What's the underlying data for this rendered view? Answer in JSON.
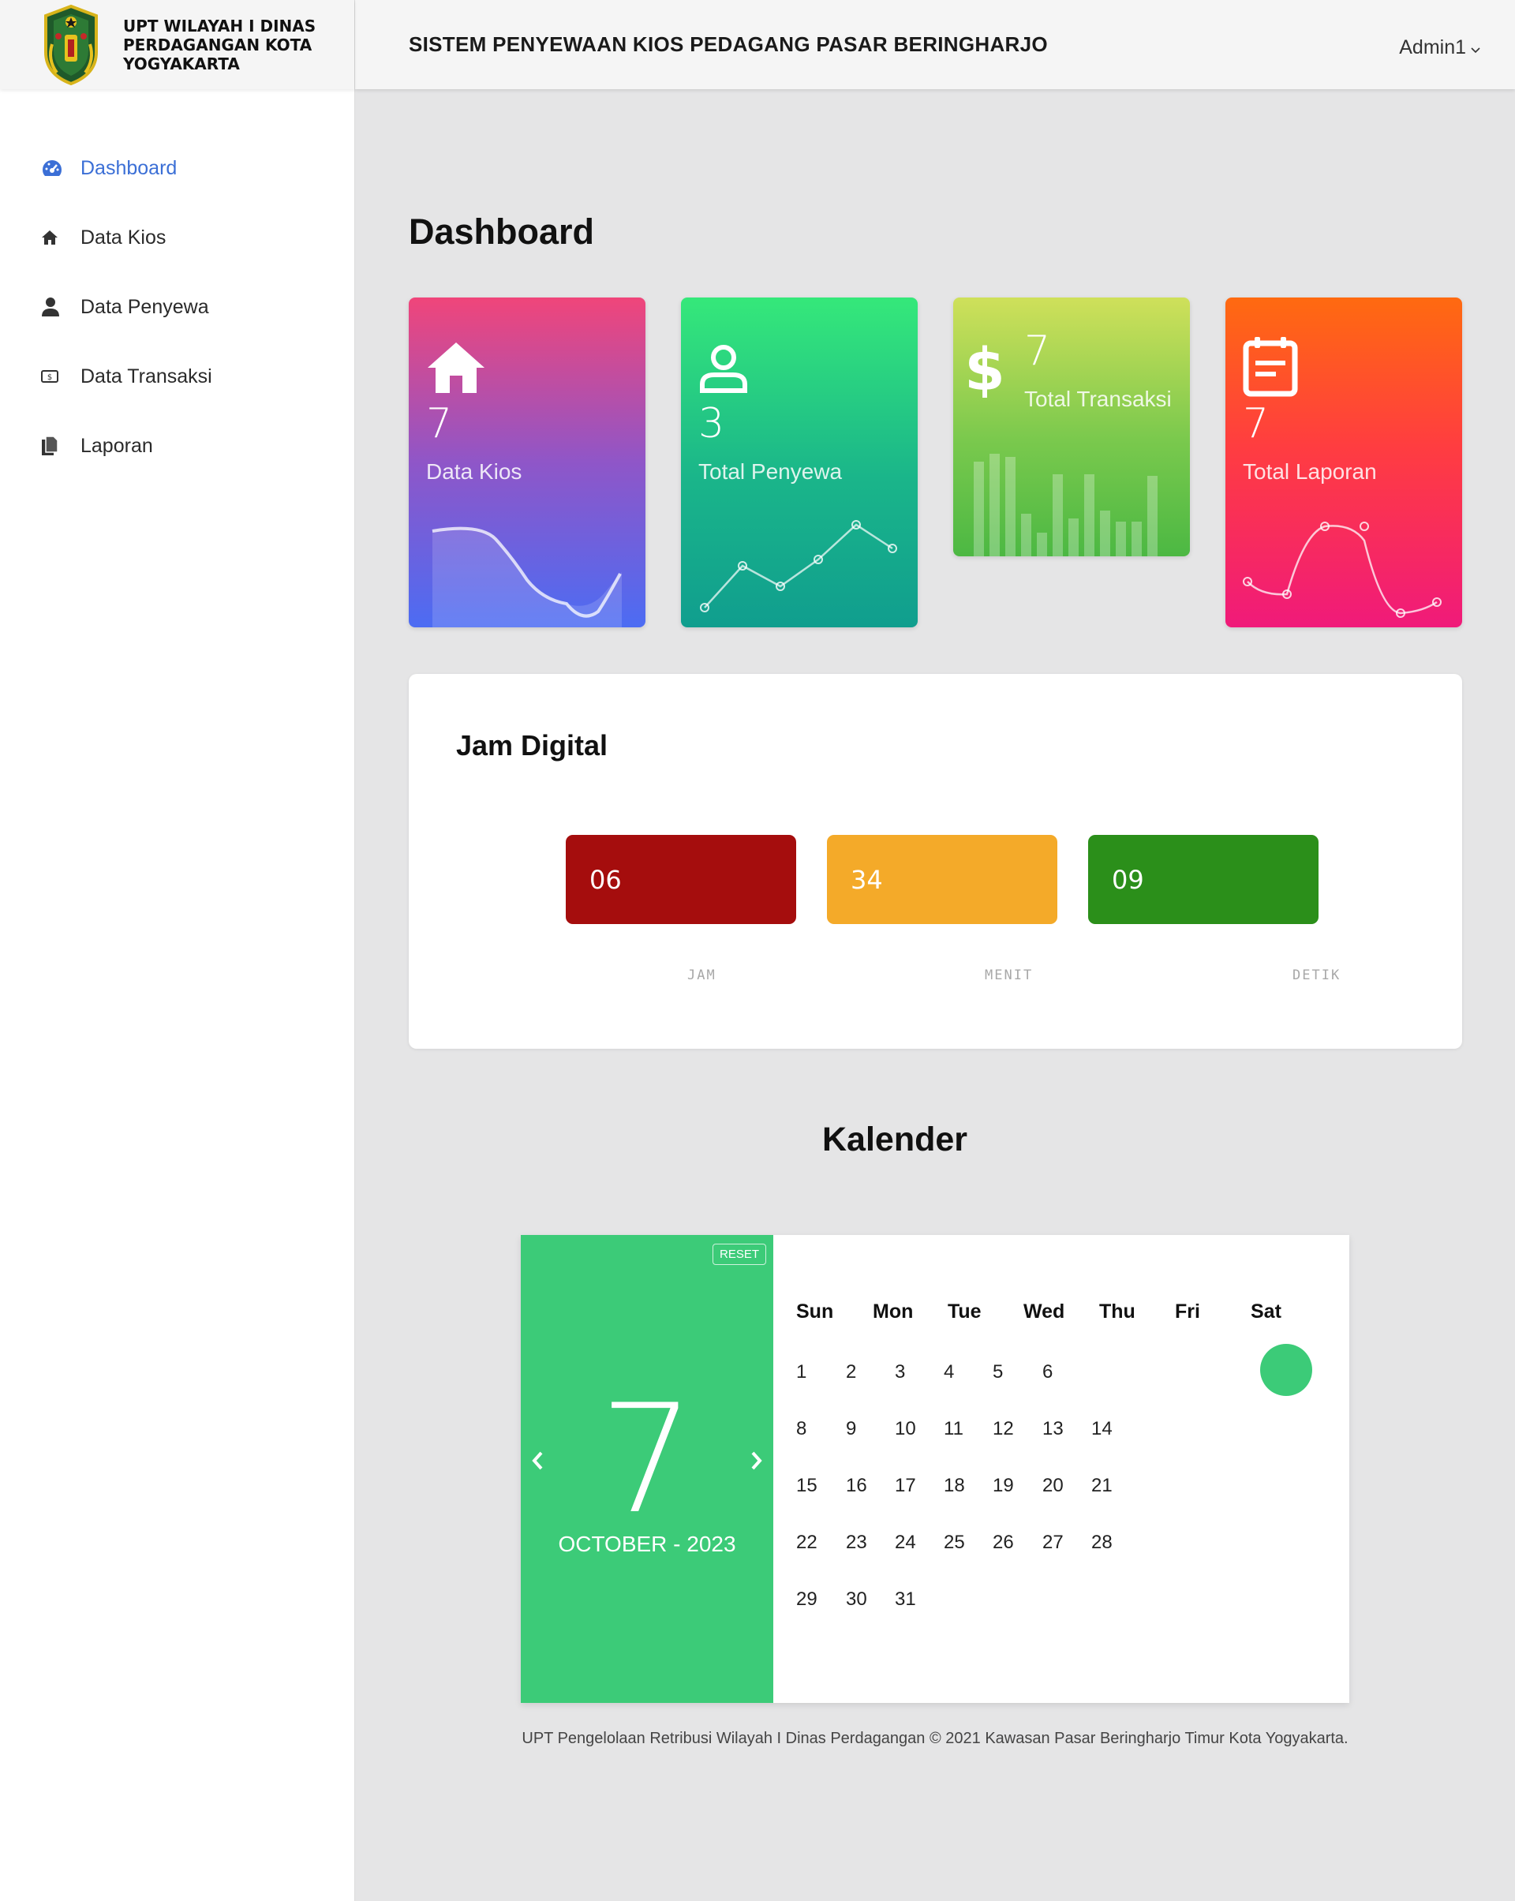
{
  "brand": {
    "name": "UPT WILAYAH I DINAS PERDAGANGAN KOTA YOGYAKARTA",
    "logo_icon": "city-emblem-icon"
  },
  "header": {
    "title": "SISTEM PENYEWAAN KIOS PEDAGANG PASAR BERINGHARJO",
    "user": "Admin1"
  },
  "sidebar": {
    "items": [
      {
        "label": "Dashboard",
        "icon": "dashboard-gauge-icon",
        "active": true
      },
      {
        "label": "Data Kios",
        "icon": "home-icon",
        "active": false
      },
      {
        "label": "Data Penyewa",
        "icon": "user-icon",
        "active": false
      },
      {
        "label": "Data Transaksi",
        "icon": "money-bill-icon",
        "active": false
      },
      {
        "label": "Laporan",
        "icon": "documents-icon",
        "active": false
      }
    ]
  },
  "main": {
    "page_title": "Dashboard",
    "cards": [
      {
        "value": "7",
        "label": "Data Kios",
        "icon": "home-icon",
        "colors": [
          "#f0457a",
          "#4c6cf3"
        ]
      },
      {
        "value": "3",
        "label": "Total Penyewa",
        "icon": "user-outline-icon",
        "colors": [
          "#35e87a",
          "#109e8e"
        ]
      },
      {
        "value": "7",
        "label": "Total Transaksi",
        "icon": "dollar-icon",
        "colors": [
          "#cfe05a",
          "#4cb843"
        ]
      },
      {
        "value": "7",
        "label": "Total Laporan",
        "icon": "calendar-note-icon",
        "colors": [
          "#ff6a10",
          "#f01a7a"
        ]
      }
    ]
  },
  "clock": {
    "title": "Jam Digital",
    "hours": "06",
    "minutes": "34",
    "seconds": "09",
    "hours_label": "JAM",
    "minutes_label": "MENIT",
    "seconds_label": "DETIK",
    "colors": {
      "hours": "#a50d0d",
      "minutes": "#f4aa29",
      "seconds": "#2b8f1a"
    }
  },
  "calendar": {
    "heading": "Kalender",
    "reset_label": "RESET",
    "selected_day": "7",
    "month_year": "OCTOBER - 2023",
    "weekdays": [
      "Sun",
      "Mon",
      "Tue",
      "Wed",
      "Thu",
      "Fri",
      "Sat"
    ],
    "weeks": [
      [
        "1",
        "2",
        "3",
        "4",
        "5",
        "6",
        ""
      ],
      [
        "8",
        "9",
        "10",
        "11",
        "12",
        "13",
        "14"
      ],
      [
        "15",
        "16",
        "17",
        "18",
        "19",
        "20",
        "21"
      ],
      [
        "22",
        "23",
        "24",
        "25",
        "26",
        "27",
        "28"
      ],
      [
        "29",
        "30",
        "31",
        "",
        "",
        "",
        ""
      ]
    ],
    "accent": "#3ccb78"
  },
  "footer": {
    "text": "UPT Pengelolaan Retribusi Wilayah I Dinas Perdagangan © 2021 Kawasan Pasar Beringharjo Timur Kota Yogyakarta."
  }
}
